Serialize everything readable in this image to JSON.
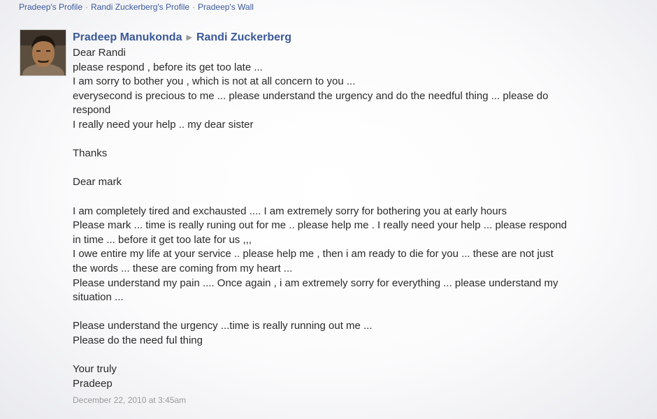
{
  "breadcrumb": [
    "Pradeep's Profile",
    "Randi Zuckerberg's Profile",
    "Pradeep's Wall"
  ],
  "post": {
    "author": "Pradeep Manukonda",
    "recipient": "Randi Zuckerberg",
    "lines": [
      "Dear Randi",
      "please respond , before its get too late ...",
      "I am sorry to bother you , which is not at all concern to you ...",
      "everysecond is precious to me ... please understand the urgency and do the needful thing ... please do",
      "respond",
      "I really need your help .. my dear sister",
      "",
      "Thanks",
      "",
      "Dear mark",
      "",
      "I am completely tired and exchausted .... I am extremely sorry for bothering you at early hours",
      "Please mark ... time is really runing out for me .. please help me . I really need your help ... please respond",
      "in time ... before it get too late for us ,,,",
      "I owe entire my life at your service .. please help me , then i am ready to die for you ... these are not just",
      "the words ... these are coming from my heart ...",
      "Please understand my pain .... Once again , i am extremely sorry for everything ... please understand my",
      "situation ...",
      "",
      "Please understand the urgency ...time is really running out me ...",
      "Please do the need ful thing",
      "",
      "Your truly",
      "Pradeep"
    ],
    "timestamp": "December 22, 2010 at 3:45am"
  }
}
